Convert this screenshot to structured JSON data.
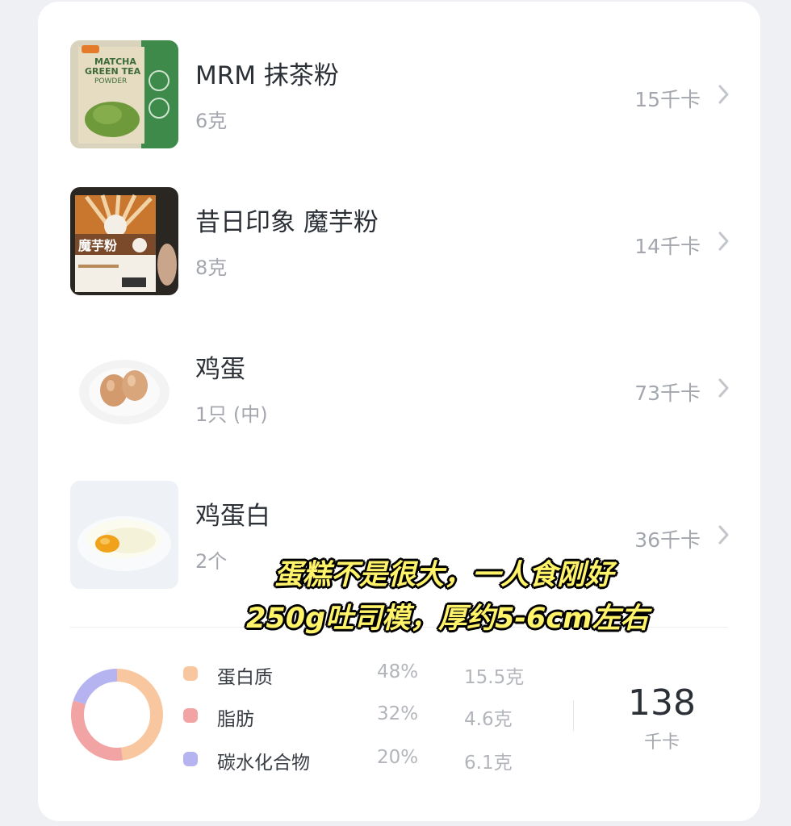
{
  "foods": [
    {
      "name": "MRM 抹茶粉",
      "qty": "6克",
      "kcal": "15千卡",
      "thumb": "matcha-powder-bag-image"
    },
    {
      "name": "昔日印象 魔芋粉",
      "qty": "8克",
      "kcal": "14千卡",
      "thumb": "konjac-powder-bag-image",
      "bag_text": "魔芋粉"
    },
    {
      "name": "鸡蛋",
      "qty": "1只 (中)",
      "kcal": "73千卡",
      "thumb": "eggs-on-plate-image"
    },
    {
      "name": "鸡蛋白",
      "qty": "2个",
      "kcal": "36千卡",
      "thumb": "egg-white-bowl-image"
    }
  ],
  "matcha_bag": {
    "line1": "MATCHA",
    "line2": "GREEN TEA",
    "line3": "POWDER"
  },
  "nutrition": {
    "items": [
      {
        "label": "蛋白质",
        "percent": "48%",
        "grams": "15.5克",
        "color": "#f8c79f",
        "fraction": 0.48
      },
      {
        "label": "脂肪",
        "percent": "32%",
        "grams": "4.6克",
        "color": "#f2a3a4",
        "fraction": 0.32
      },
      {
        "label": "碳水化合物",
        "percent": "20%",
        "grams": "6.1克",
        "color": "#b6b3f1",
        "fraction": 0.2
      }
    ],
    "total": "138",
    "total_unit": "千卡"
  },
  "overlay_caption": {
    "line1": "蛋糕不是很大，一人食刚好",
    "line2": "250g吐司模，厚约5-6cm左右"
  },
  "icons": {
    "chevron": "chevron-right-icon"
  }
}
